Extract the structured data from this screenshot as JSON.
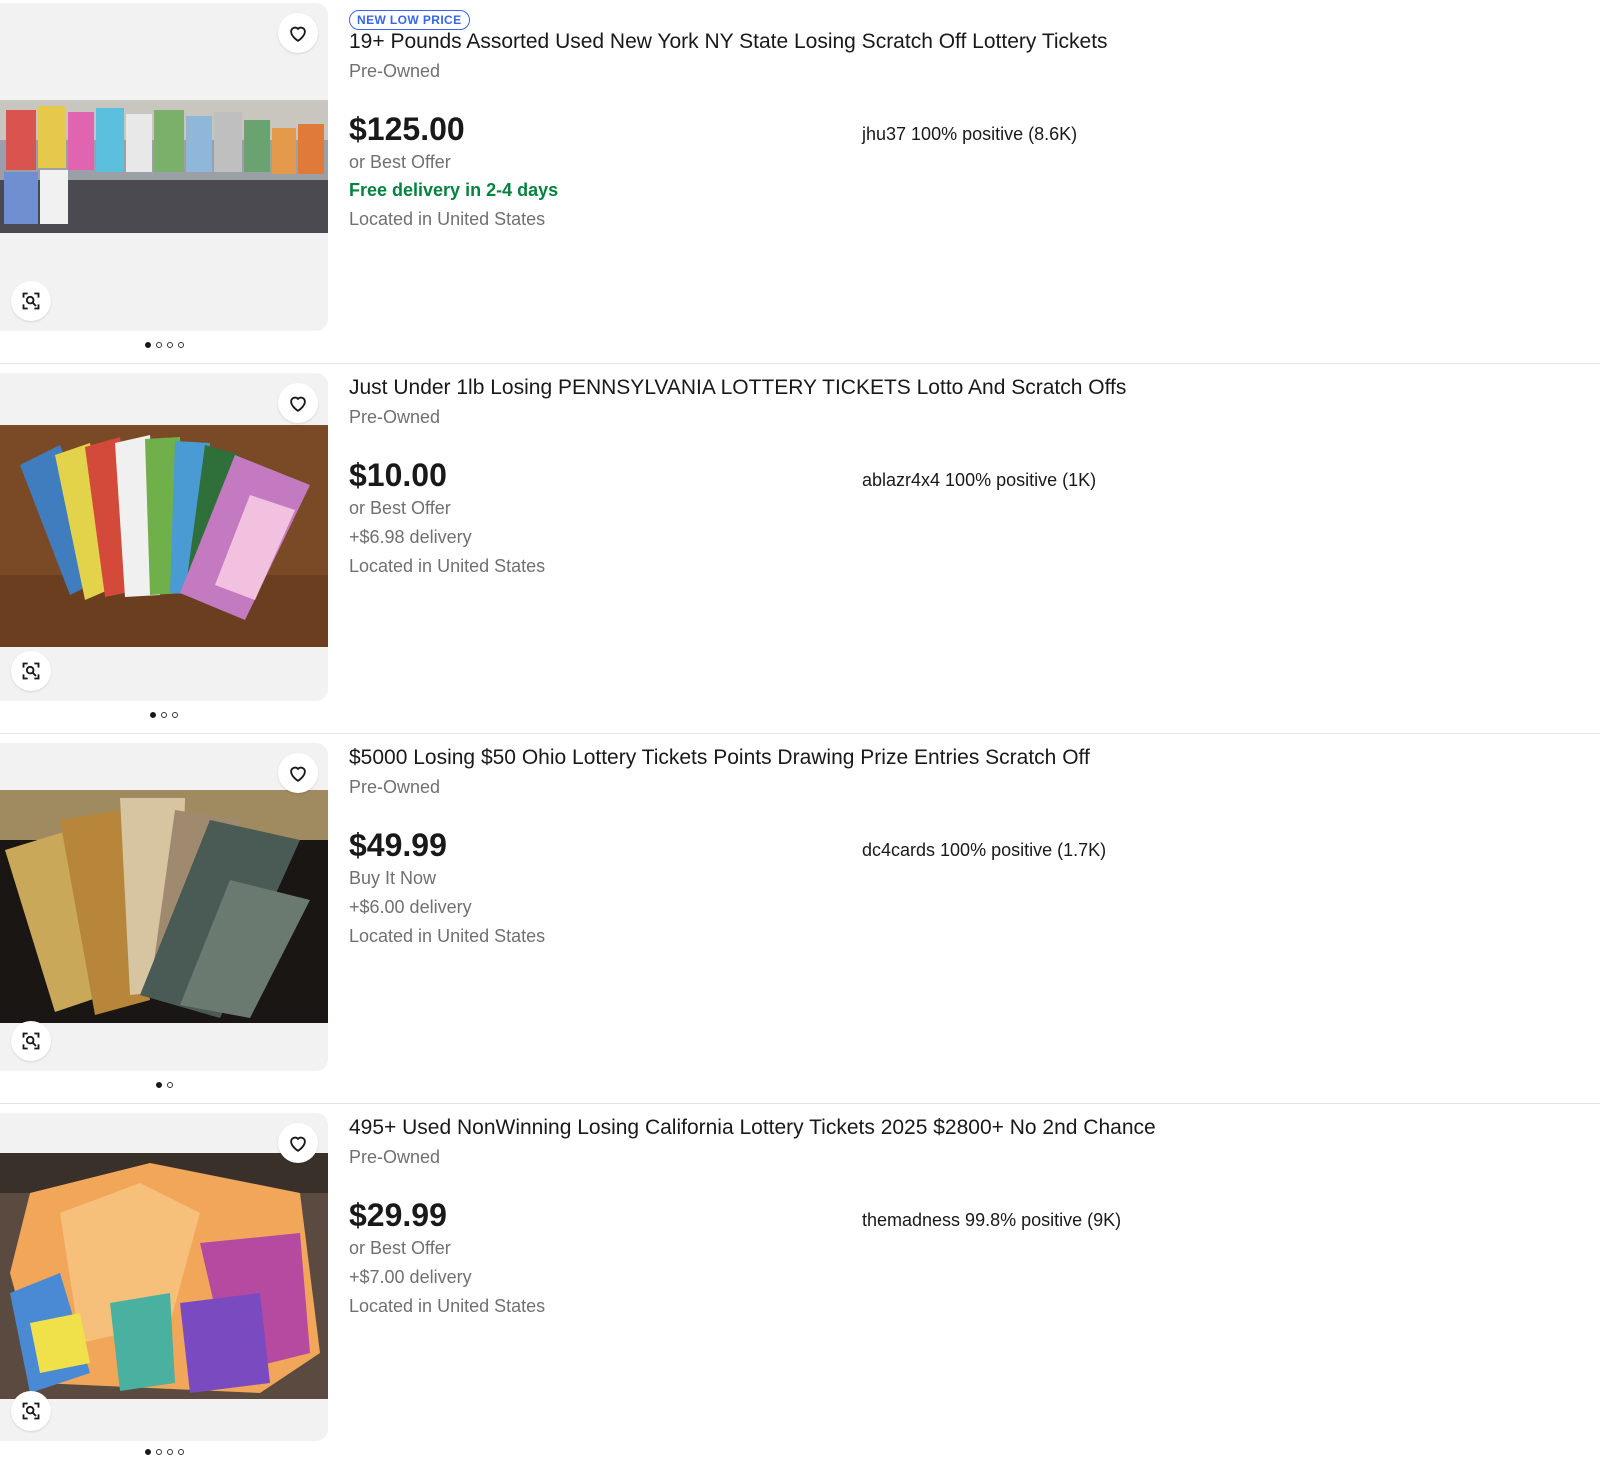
{
  "colors": {
    "accent": "#3665f3",
    "free_shipping": "#05823f",
    "muted_text": "#707070",
    "text": "#191919"
  },
  "listings": [
    {
      "badge": "NEW LOW PRICE",
      "title": "19+ Pounds Assorted Used New York NY State Losing Scratch Off Lottery Tickets",
      "condition": "Pre-Owned",
      "price": "$125.00",
      "purchase_option": "or Best Offer",
      "shipping": "Free delivery in 2-4 days",
      "location": "Located in United States",
      "seller": "jhu37 100% positive (8.6K)",
      "image_count": 4
    },
    {
      "badge": "",
      "title": "Just Under 1lb Losing PENNSYLVANIA LOTTERY TICKETS Lotto And Scratch Offs",
      "condition": "Pre-Owned",
      "price": "$10.00",
      "purchase_option": "or Best Offer",
      "shipping": "+$6.98 delivery",
      "location": "Located in United States",
      "seller": "ablazr4x4 100% positive (1K)",
      "image_count": 3
    },
    {
      "badge": "",
      "title": "$5000 Losing $50 Ohio Lottery Tickets Points Drawing Prize Entries Scratch Off",
      "condition": "Pre-Owned",
      "price": "$49.99",
      "purchase_option": "Buy It Now",
      "shipping": "+$6.00 delivery",
      "location": "Located in United States",
      "seller": "dc4cards 100% positive (1.7K)",
      "image_count": 2
    },
    {
      "badge": "",
      "title": "495+ Used NonWinning Losing California Lottery Tickets 2025 $2800+ No 2nd Chance",
      "condition": "Pre-Owned",
      "price": "$29.99",
      "purchase_option": "or Best Offer",
      "shipping": "+$7.00 delivery",
      "location": "Located in United States",
      "seller": "themadness 99.8% positive (9K)",
      "image_count": 4
    }
  ]
}
